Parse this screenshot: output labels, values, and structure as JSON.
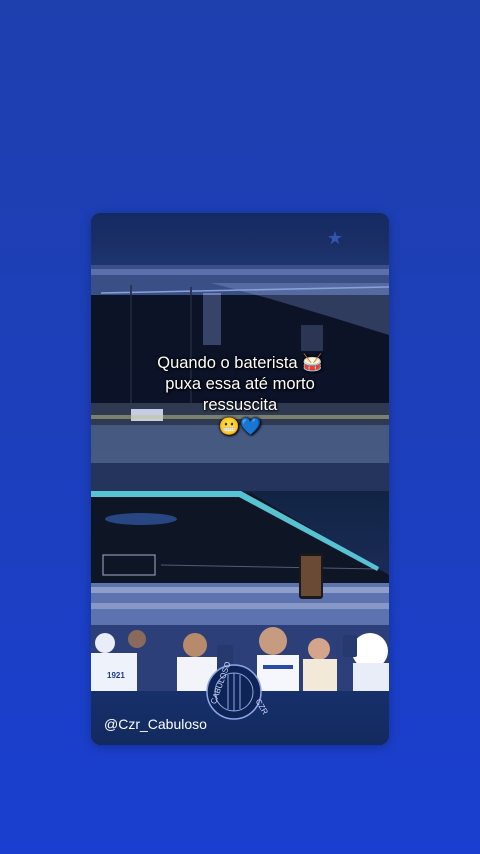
{
  "post": {
    "caption_line1": "Quando o baterista 🥁",
    "caption_line2": "puxa essa até morto",
    "caption_line3": "ressuscita",
    "caption_emojis": "😬💙",
    "handle": "@Czr_Cabuloso",
    "watermark_left": "CABULOSO",
    "watermark_right": "CZR",
    "jersey_number": "1921"
  },
  "colors": {
    "background_top": "#1e3fae",
    "background_bottom": "#1a3fd0",
    "card_band": "#17306b",
    "pitch_light": "#5fd6e6"
  },
  "icons": {
    "top_band_icon": "star-icon"
  }
}
